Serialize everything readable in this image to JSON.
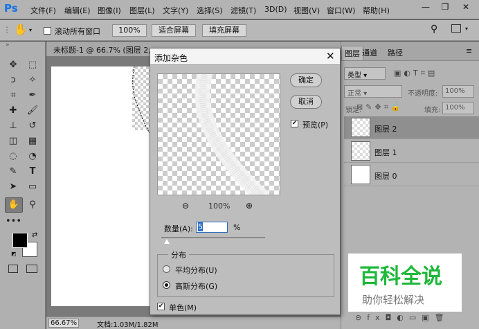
{
  "app": {
    "logo": "Ps"
  },
  "menu": [
    "文件(F)",
    "编辑(E)",
    "图像(I)",
    "图层(L)",
    "文字(Y)",
    "选择(S)",
    "滤镜(T)",
    "3D(D)",
    "视图(V)",
    "窗口(W)",
    "帮助(H)"
  ],
  "window_controls": {
    "minimize": "—",
    "restore": "❐",
    "close": "✕"
  },
  "options_bar": {
    "scroll_all_label": "滚动所有窗口",
    "zoom_label": "100%",
    "fit_screen_label": "适合屏幕",
    "fill_screen_label": "填充屏幕"
  },
  "document": {
    "tab_title": "未标题-1 @ 66.7% (图层 2, RGB/8)",
    "zoom": "66.67%",
    "status": "文档:1.03M/1.82M"
  },
  "dialog": {
    "title": "添加杂色",
    "ok_label": "确定",
    "cancel_label": "取消",
    "preview_label": "预览(P)",
    "preview_zoom": "100%",
    "amount_label": "数量(A):",
    "amount_value": "5",
    "amount_unit": "%",
    "distribution_label": "分布",
    "uniform_label": "平均分布(U)",
    "gaussian_label": "高斯分布(G)",
    "mono_label": "单色(M)"
  },
  "layers_panel": {
    "tabs": [
      "图层",
      "通道",
      "路径"
    ],
    "kind_label": "类型",
    "blend_mode": "正常",
    "opacity_label": "不透明度:",
    "opacity_value": "100%",
    "lock_label": "锁定:",
    "fill_label": "填充:",
    "fill_value": "100%",
    "layers": [
      "图层 2",
      "图层 1",
      "图层 0"
    ]
  },
  "watermark": {
    "title": "百科全说",
    "subtitle": "助你轻松解决"
  },
  "colors": {
    "accent": "#1473e6",
    "watermark_green": "#1fb83a"
  }
}
